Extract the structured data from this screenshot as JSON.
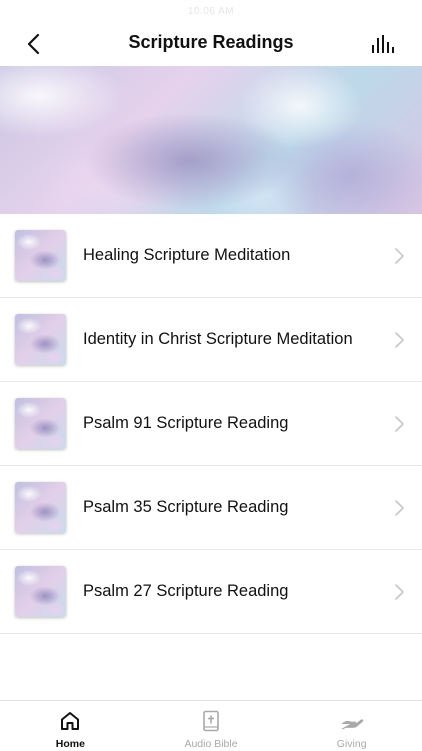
{
  "status": {
    "time": "10:06 AM"
  },
  "header": {
    "title": "Scripture Readings"
  },
  "items": [
    {
      "label": "Healing Scripture Meditation"
    },
    {
      "label": "Identity in Christ Scripture Meditation"
    },
    {
      "label": "Psalm 91 Scripture Reading"
    },
    {
      "label": "Psalm 35 Scripture Reading"
    },
    {
      "label": "Psalm 27 Scripture Reading"
    }
  ],
  "tabbar": {
    "home_label": "Home",
    "bible_label": "Audio Bible",
    "giving_label": "Giving"
  },
  "icons": {
    "back": "chevron-left-icon",
    "stats": "bar-chart-icon",
    "row_arrow": "chevron-right-icon",
    "home": "home-icon",
    "bible": "bible-icon",
    "giving": "giving-hand-icon"
  },
  "colors": {
    "active_tab": "#111111",
    "inactive_tab": "#a9a9a9",
    "divider": "#e9e9e9"
  }
}
